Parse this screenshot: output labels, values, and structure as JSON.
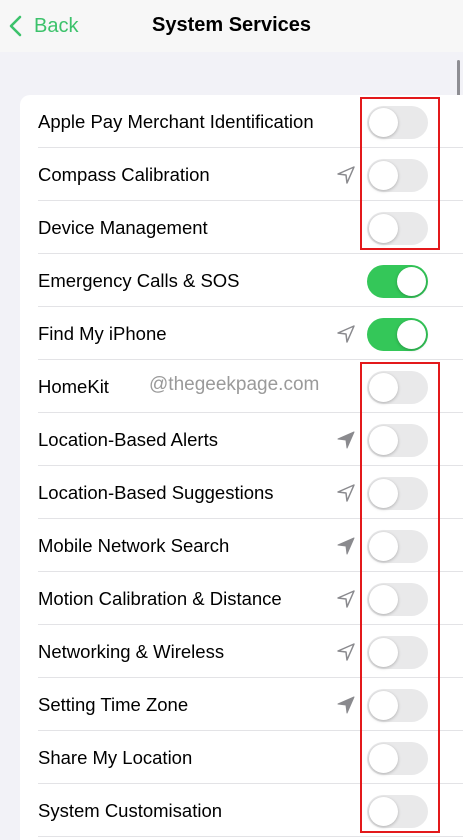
{
  "nav": {
    "back_label": "Back",
    "title": "System Services"
  },
  "watermark": "@thegeekpage.com",
  "colors": {
    "accent": "#3cc26b",
    "toggle_on": "#34c759",
    "toggle_off": "#e9e9ea",
    "highlight": "#e3191b"
  },
  "rows": [
    {
      "label": "Apple Pay Merchant Identification",
      "on": false,
      "location_icon": "none"
    },
    {
      "label": "Compass Calibration",
      "on": false,
      "location_icon": "outline"
    },
    {
      "label": "Device Management",
      "on": false,
      "location_icon": "none"
    },
    {
      "label": "Emergency Calls & SOS",
      "on": true,
      "location_icon": "none"
    },
    {
      "label": "Find My iPhone",
      "on": true,
      "location_icon": "outline"
    },
    {
      "label": "HomeKit",
      "on": false,
      "location_icon": "none"
    },
    {
      "label": "Location-Based Alerts",
      "on": false,
      "location_icon": "filled"
    },
    {
      "label": "Location-Based Suggestions",
      "on": false,
      "location_icon": "outline"
    },
    {
      "label": "Mobile Network Search",
      "on": false,
      "location_icon": "filled"
    },
    {
      "label": "Motion Calibration & Distance",
      "on": false,
      "location_icon": "outline"
    },
    {
      "label": "Networking & Wireless",
      "on": false,
      "location_icon": "outline"
    },
    {
      "label": "Setting Time Zone",
      "on": false,
      "location_icon": "filled"
    },
    {
      "label": "Share My Location",
      "on": false,
      "location_icon": "none"
    },
    {
      "label": "System Customisation",
      "on": false,
      "location_icon": "none"
    }
  ]
}
